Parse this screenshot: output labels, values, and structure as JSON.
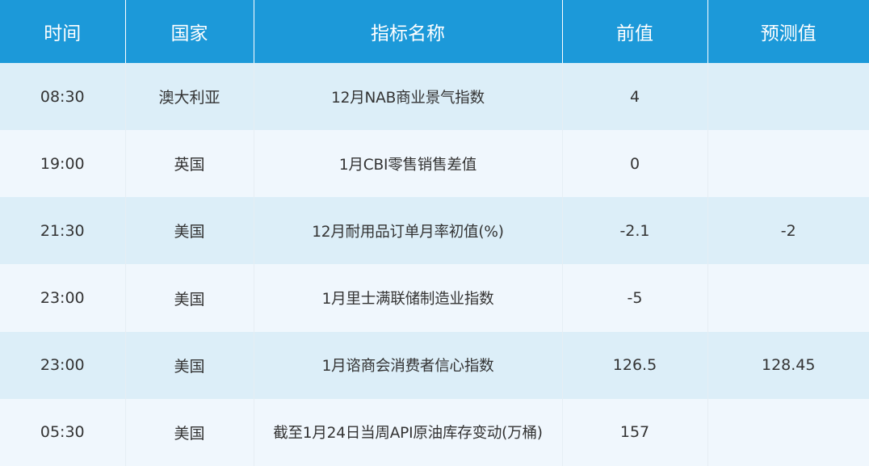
{
  "header": {
    "time": "时间",
    "country": "国家",
    "indicator": "指标名称",
    "previous": "前值",
    "forecast": "预测值"
  },
  "rows": [
    {
      "time": "08:30",
      "country": "澳大利亚",
      "indicator": "12月NAB商业景气指数",
      "previous": "4",
      "forecast": ""
    },
    {
      "time": "19:00",
      "country": "英国",
      "indicator": "1月CBI零售销售差值",
      "previous": "0",
      "forecast": ""
    },
    {
      "time": "21:30",
      "country": "美国",
      "indicator": "12月耐用品订单月率初值(%)",
      "previous": "-2.1",
      "forecast": "-2"
    },
    {
      "time": "23:00",
      "country": "美国",
      "indicator": "1月里士满联储制造业指数",
      "previous": "-5",
      "forecast": ""
    },
    {
      "time": "23:00",
      "country": "美国",
      "indicator": "1月谘商会消费者信心指数",
      "previous": "126.5",
      "forecast": "128.45"
    },
    {
      "time": "05:30",
      "country": "美国",
      "indicator": "截至1月24日当周API原油库存变动(万桶)",
      "previous": "157",
      "forecast": ""
    }
  ],
  "colors": {
    "header_bg": "#1c99d9",
    "row_odd_bg": "#dceef8",
    "row_even_bg": "#f0f7fd",
    "text": "#333333"
  }
}
